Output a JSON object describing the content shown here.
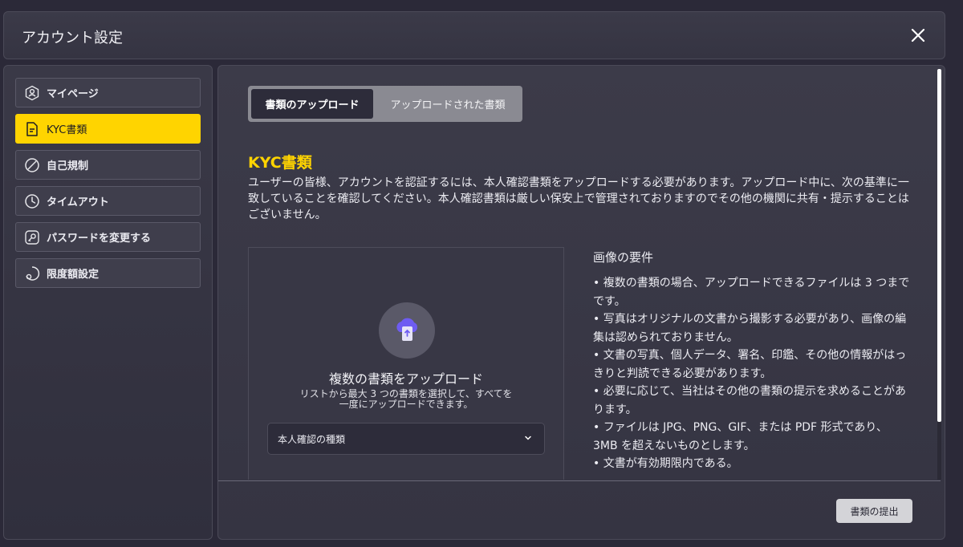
{
  "header": {
    "title": "アカウント設定"
  },
  "sidebar": {
    "items": [
      {
        "label": "マイページ",
        "icon": "user-icon",
        "active": false
      },
      {
        "label": "KYC書類",
        "icon": "document-icon",
        "active": true
      },
      {
        "label": "自己規制",
        "icon": "ban-icon",
        "active": false
      },
      {
        "label": "タイムアウト",
        "icon": "clock-icon",
        "active": false
      },
      {
        "label": "パスワードを変更する",
        "icon": "key-icon",
        "active": false
      },
      {
        "label": "限度額設定",
        "icon": "limit-icon",
        "active": false
      }
    ]
  },
  "main": {
    "tabs": [
      {
        "label": "書類のアップロード",
        "active": true
      },
      {
        "label": "アップロードされた書類",
        "active": false
      }
    ],
    "section_title": "KYC書類",
    "intro": "ユーザーの皆様、アカウントを認証するには、本人確認書類をアップロードする必要があります。アップロード中に、次の基準に一致していることを確認してください。本人確認書類は厳しい保安上で管理されておりますのでその他の機関に共有・提示することはございません。",
    "upload": {
      "title": "複数の書類をアップロード",
      "description": "リストから最大 3 つの書類を選択して、すべてを一度にアップロードできます。",
      "select_value": "本人確認の種類",
      "icon": "cloud-upload-icon"
    },
    "requirements": {
      "title": "画像の要件",
      "items": [
        "複数の書類の場合、アップロードできるファイルは 3 つまでです。",
        "写真はオリジナルの文書から撮影する必要があり、画像の編集は認められておりません。",
        "文書の写真、個人データ、署名、印鑑、その他の情報がはっきりと判読できる必要があります。",
        "必要に応じて、当社はその他の書類の提示を求めることがあります。",
        "ファイルは JPG、PNG、GIF、または PDF 形式であり、3MB を超えないものとします。",
        "文書が有効期限内である。"
      ]
    },
    "submit_label": "書類の提出"
  },
  "colors": {
    "accent": "#ffd400",
    "background": "#2b2938",
    "upload_icon": "#6e5cf2"
  }
}
